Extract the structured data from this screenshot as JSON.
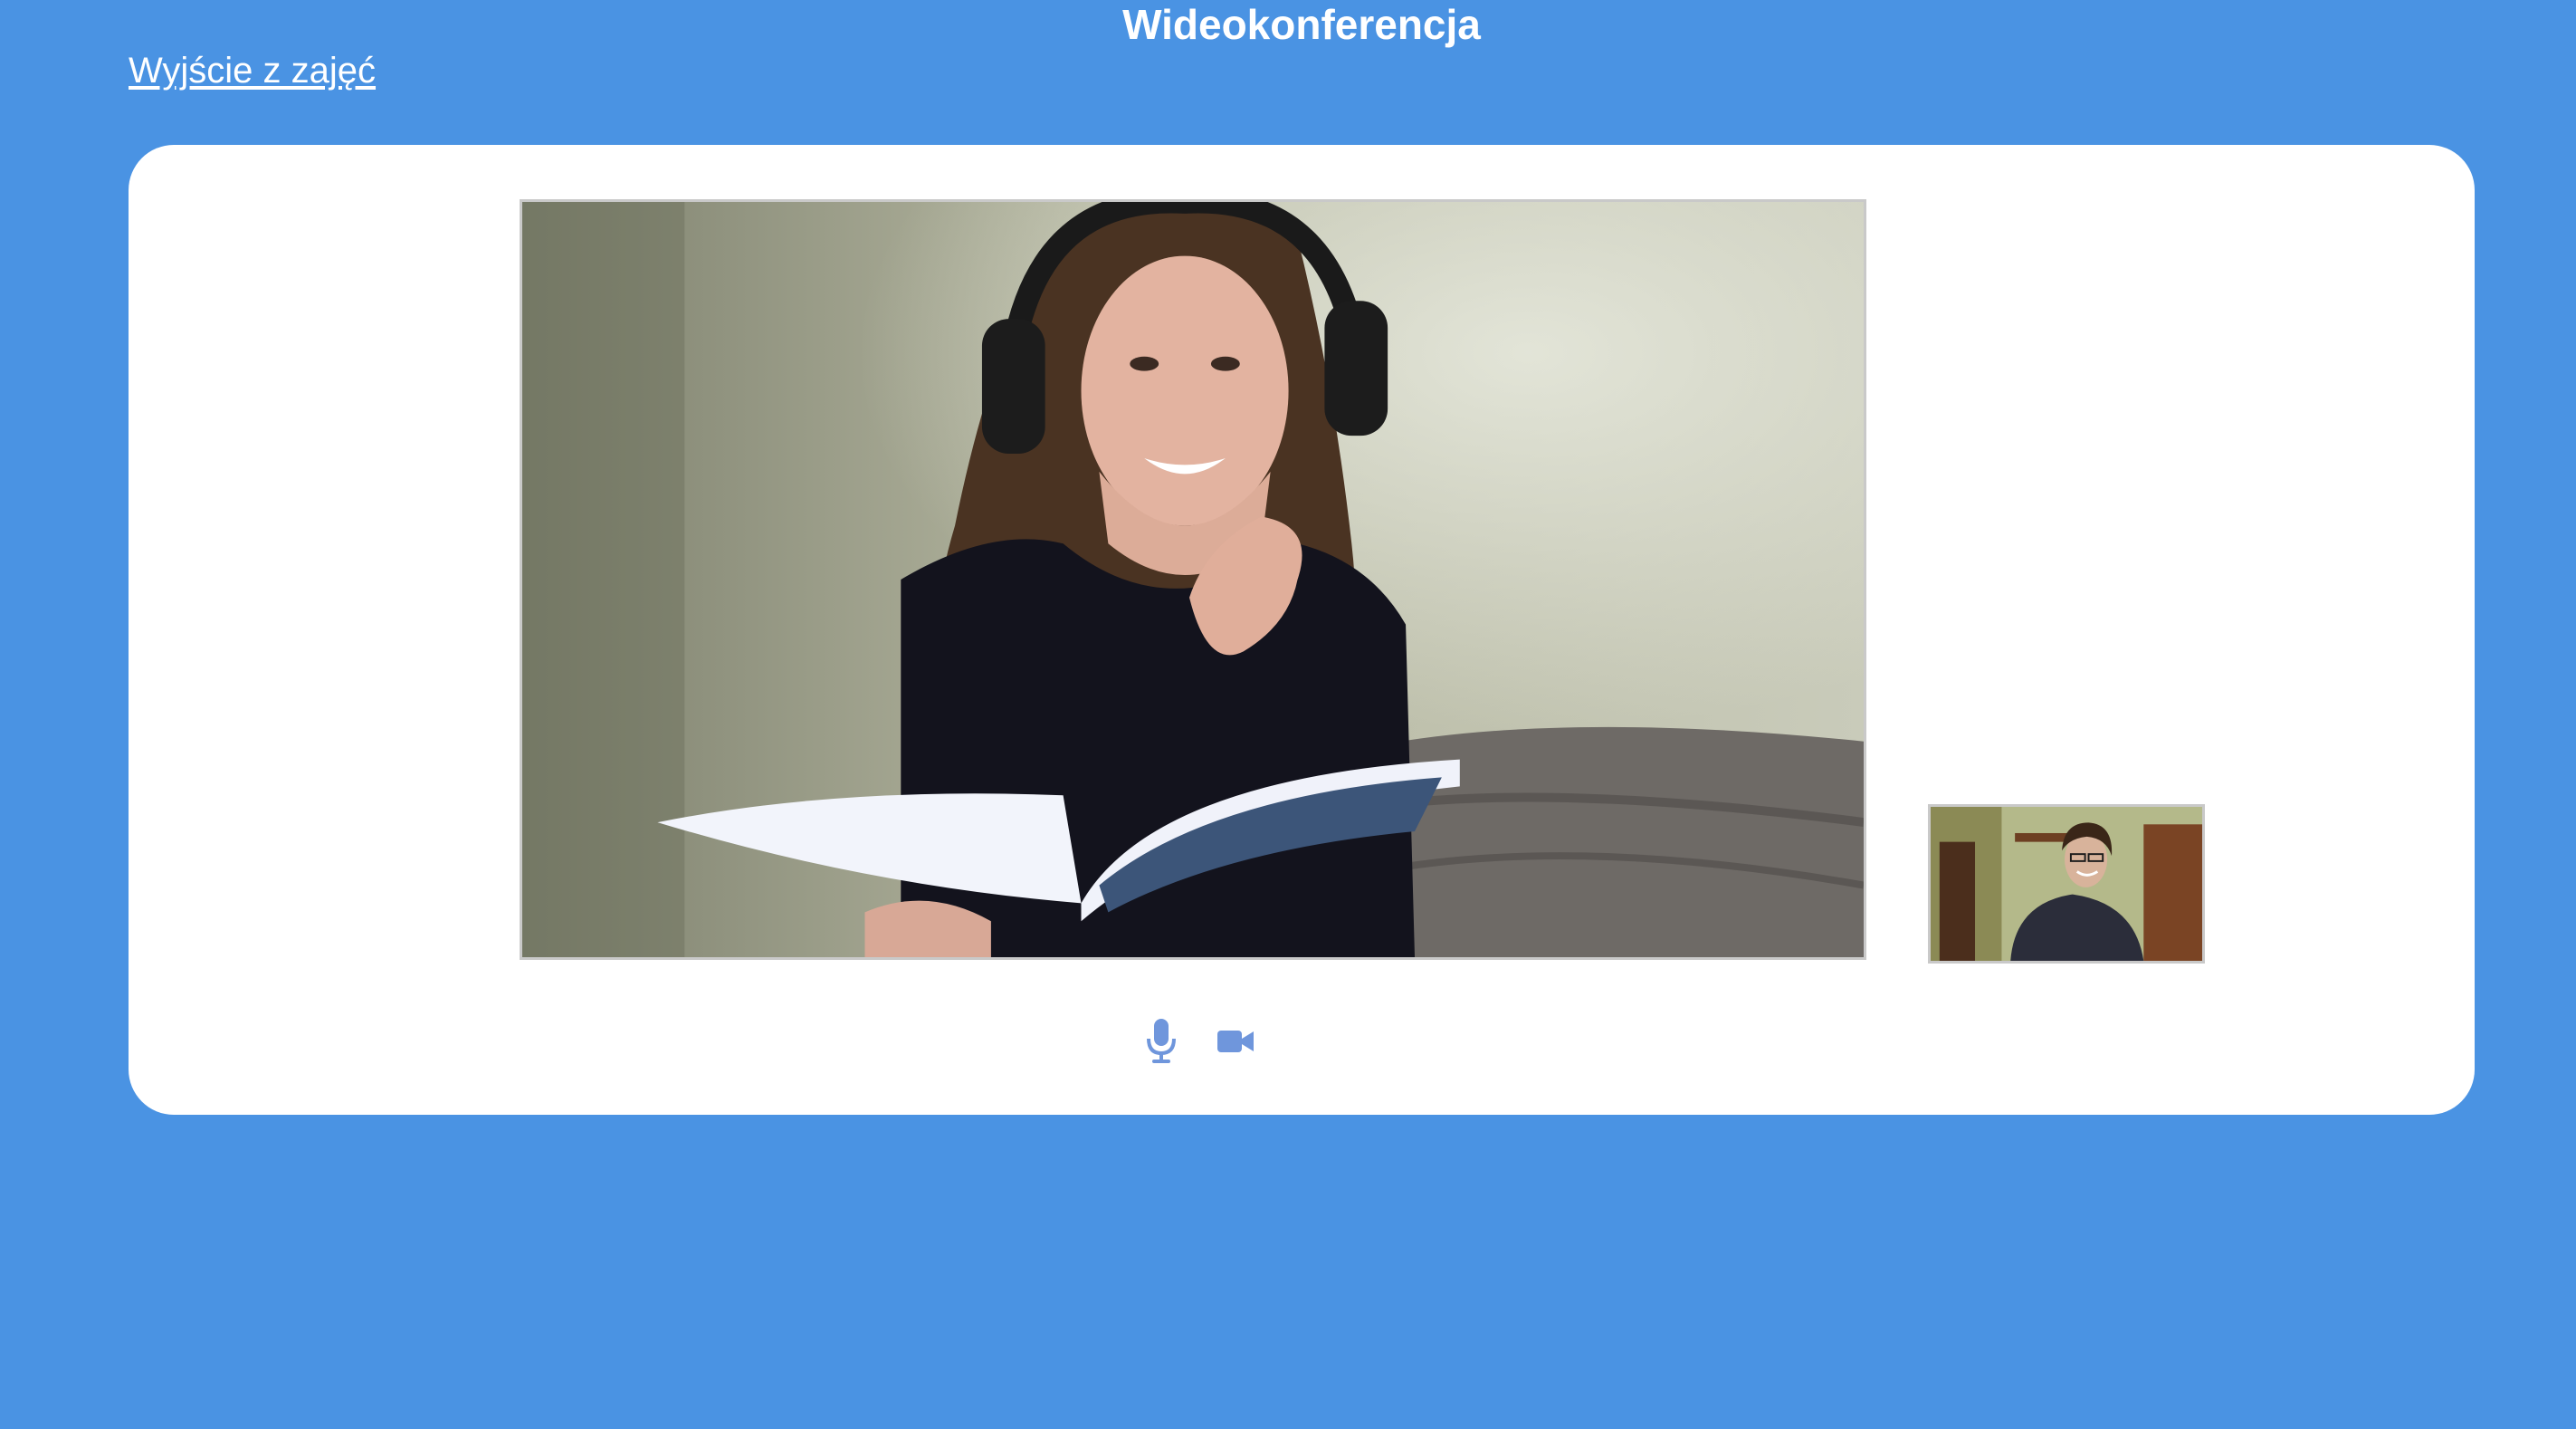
{
  "header": {
    "title": "Wideokonferencja",
    "exit_link": "Wyjście z zajęć"
  },
  "colors": {
    "background": "#4a93e3",
    "panel": "#ffffff",
    "icon": "#6f96dc"
  },
  "controls": {
    "microphone_icon": "microphone-icon",
    "camera_icon": "video-camera-icon"
  }
}
